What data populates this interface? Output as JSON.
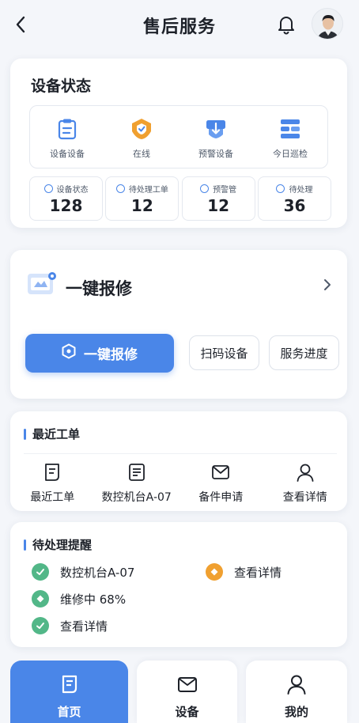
{
  "header": {
    "title": "售后服务"
  },
  "device_status": {
    "title": "设备状态",
    "shortcuts": [
      {
        "label": "设备设备",
        "icon": "clipboard-icon"
      },
      {
        "label": "在线",
        "icon": "shield-icon"
      },
      {
        "label": "预警设备",
        "icon": "alert-download-icon"
      },
      {
        "label": "今日巡检",
        "icon": "list-stack-icon"
      }
    ],
    "stats": [
      {
        "label": "设备状态",
        "value": "128"
      },
      {
        "label": "待处理工单",
        "value": "12"
      },
      {
        "label": "预警管",
        "value": "12"
      },
      {
        "label": "待处理",
        "value": "36"
      }
    ]
  },
  "repair": {
    "title": "一键报修",
    "primary_label": "一键报修",
    "scan_label": "扫码设备",
    "progress_label": "服务进度"
  },
  "recent_orders": {
    "title": "最近工单",
    "actions": [
      {
        "label": "最近工单",
        "icon": "document-icon"
      },
      {
        "label": "数控机台A-07",
        "icon": "document-list-icon"
      },
      {
        "label": "备件申请",
        "icon": "envelope-icon"
      },
      {
        "label": "查看详情",
        "icon": "user-icon"
      }
    ]
  },
  "reminders": {
    "title": "待处理提醒",
    "items": [
      {
        "text": "数控机台A-07",
        "icon": "check-badge-icon",
        "color": "#52b788"
      },
      {
        "text": "查看详情",
        "icon": "alert-badge-icon",
        "color": "#f0a030"
      },
      {
        "text": "维修中 68%",
        "icon": "diamond-badge-icon",
        "color": "#52b788"
      },
      {
        "text": "查看详情",
        "icon": "check-badge-icon",
        "color": "#52b788"
      }
    ]
  },
  "tabbar": [
    {
      "label": "首页",
      "icon": "home-doc-icon",
      "active": true
    },
    {
      "label": "设备",
      "icon": "envelope-icon",
      "active": false
    },
    {
      "label": "我的",
      "icon": "user-icon",
      "active": false
    }
  ],
  "colors": {
    "primary": "#4a86e8",
    "accent_orange": "#f0a030",
    "success_green": "#52b788"
  }
}
